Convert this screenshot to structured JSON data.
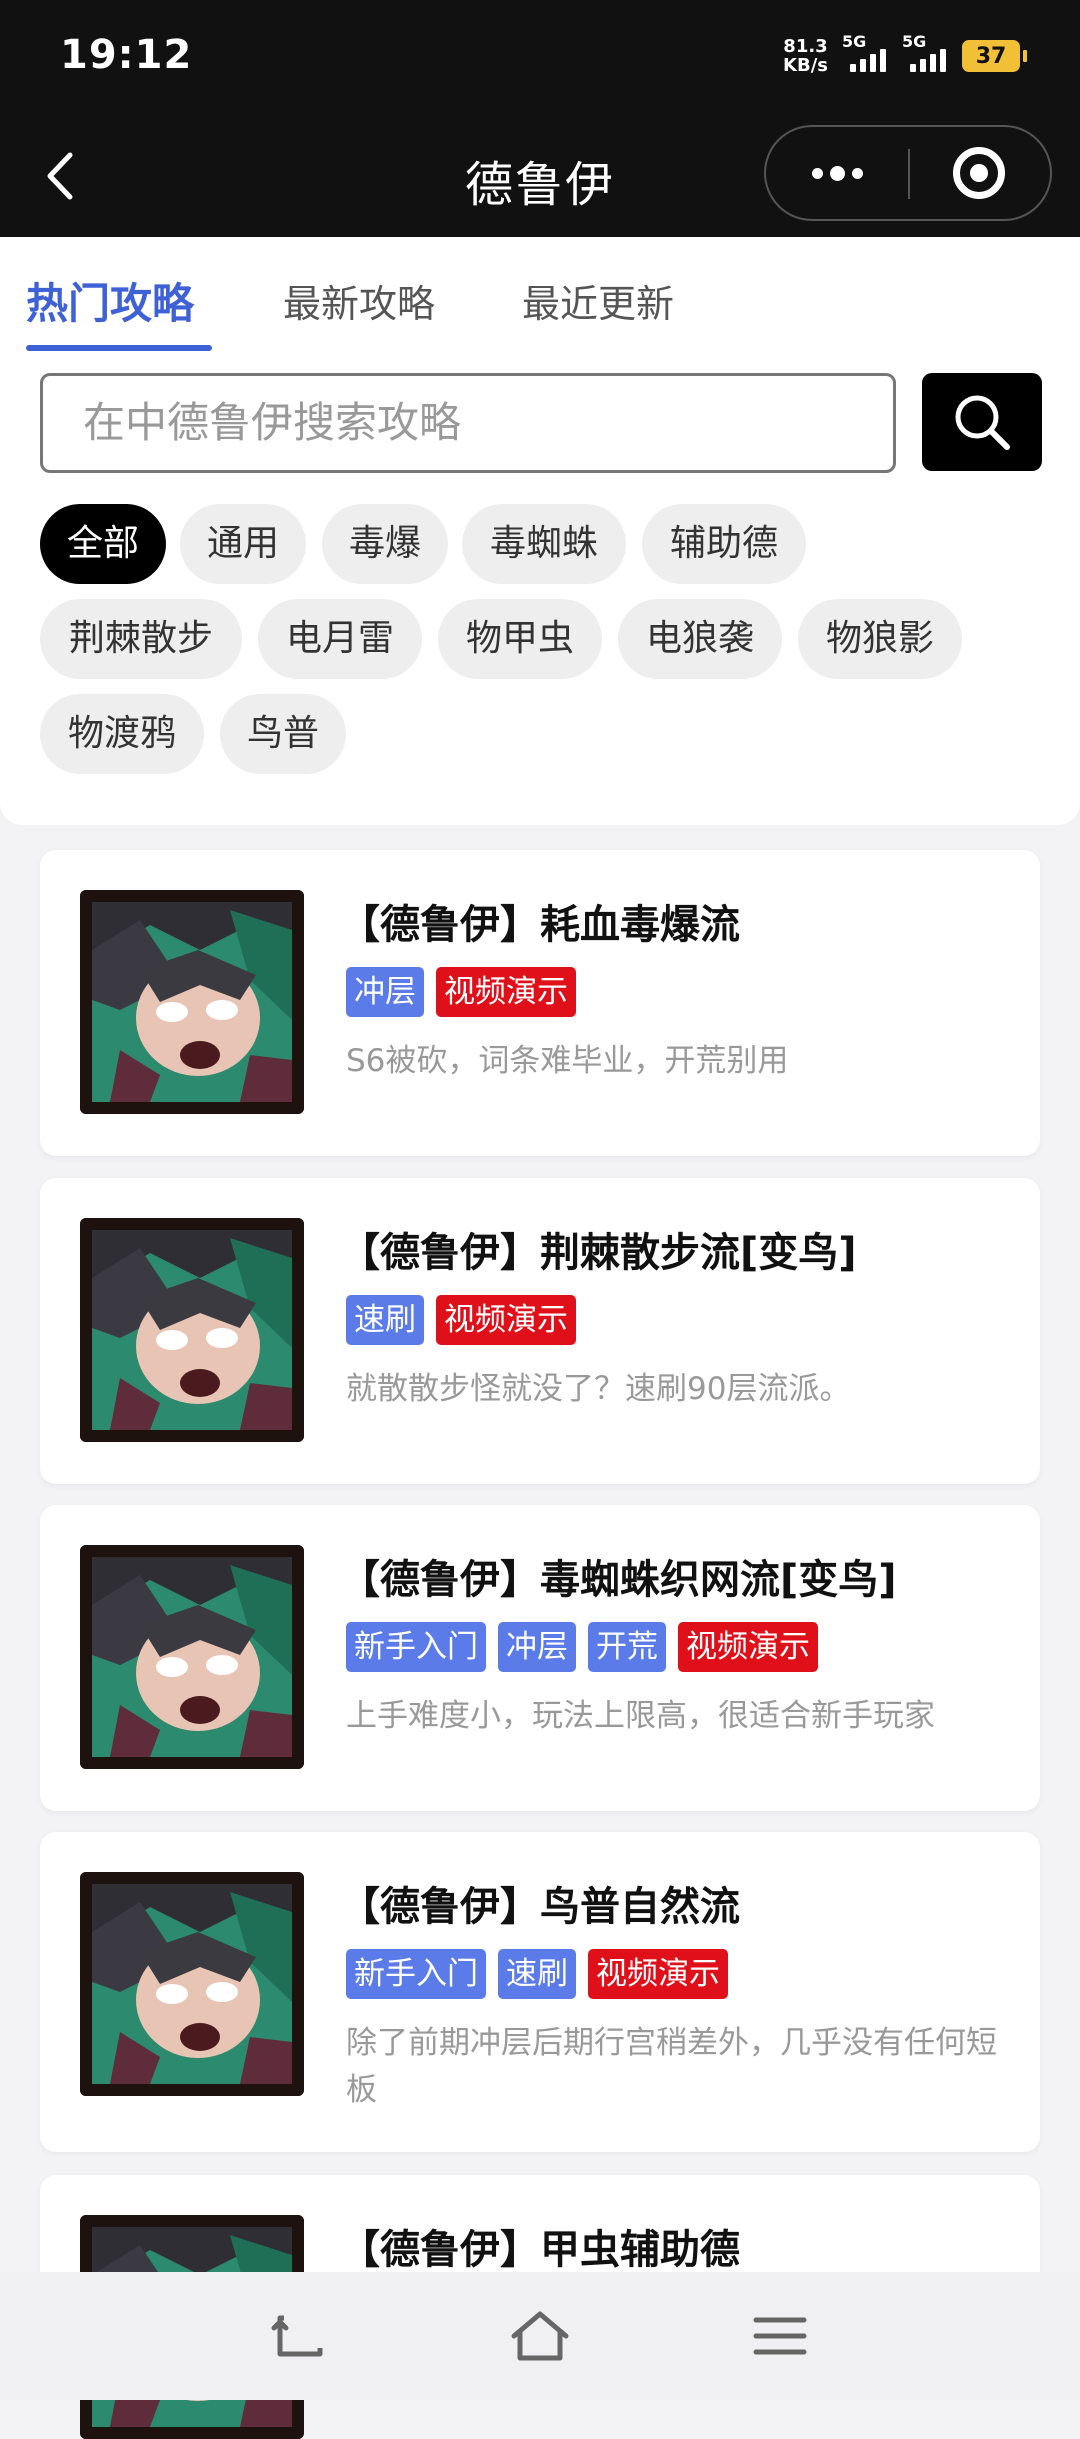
{
  "status_bar": {
    "time": "19:12",
    "net_speed_value": "81.3",
    "net_speed_unit": "KB/s",
    "sim1_label": "5G",
    "sim2_label": "5G",
    "battery": "37",
    "battery_color": "#f1c037"
  },
  "nav": {
    "title": "德鲁伊",
    "back_icon": "chevron-left-icon",
    "more_icon": "more-dots-icon",
    "close_icon": "target-close-icon"
  },
  "tabs": [
    {
      "label": "热门攻略",
      "active": true
    },
    {
      "label": "最新攻略",
      "active": false
    },
    {
      "label": "最近更新",
      "active": false
    }
  ],
  "search": {
    "placeholder": "在中德鲁伊搜索攻略",
    "button_icon": "search-icon"
  },
  "filters": [
    {
      "label": "全部",
      "active": true
    },
    {
      "label": "通用"
    },
    {
      "label": "毒爆"
    },
    {
      "label": "毒蜘蛛"
    },
    {
      "label": "辅助德"
    },
    {
      "label": "荆棘散步"
    },
    {
      "label": "电月雷"
    },
    {
      "label": "物甲虫"
    },
    {
      "label": "电狼袭"
    },
    {
      "label": "物狼影"
    },
    {
      "label": "物渡鸦"
    },
    {
      "label": "鸟普"
    }
  ],
  "guides": [
    {
      "title": "【德鲁伊】耗血毒爆流",
      "tags": [
        {
          "text": "冲层",
          "color": "blue"
        },
        {
          "text": "视频演示",
          "color": "red"
        }
      ],
      "desc": "S6被砍，词条难毕业，开荒别用"
    },
    {
      "title": "【德鲁伊】荆棘散步流[变鸟]",
      "tags": [
        {
          "text": "速刷",
          "color": "blue"
        },
        {
          "text": "视频演示",
          "color": "red"
        }
      ],
      "desc": "就散散步怪就没了？速刷90层流派。"
    },
    {
      "title": "【德鲁伊】毒蜘蛛织网流[变鸟]",
      "tags": [
        {
          "text": "新手入门",
          "color": "blue"
        },
        {
          "text": "冲层",
          "color": "blue"
        },
        {
          "text": "开荒",
          "color": "blue"
        },
        {
          "text": "视频演示",
          "color": "red"
        }
      ],
      "desc": "上手难度小，玩法上限高，很适合新手玩家"
    },
    {
      "title": "【德鲁伊】鸟普自然流",
      "tags": [
        {
          "text": "新手入门",
          "color": "blue"
        },
        {
          "text": "速刷",
          "color": "blue"
        },
        {
          "text": "视频演示",
          "color": "red"
        }
      ],
      "desc": "除了前期冲层后期行宫稍差外，几乎没有任何短板"
    },
    {
      "title": "【德鲁伊】甲虫辅助德",
      "tags": [],
      "desc": ""
    }
  ],
  "colors": {
    "accent": "#3e62d6",
    "tag_blue": "#5b7be8",
    "tag_red": "#e0101a"
  },
  "bottom_nav": {
    "icons": [
      "back-icon",
      "home-icon",
      "menu-icon"
    ]
  }
}
